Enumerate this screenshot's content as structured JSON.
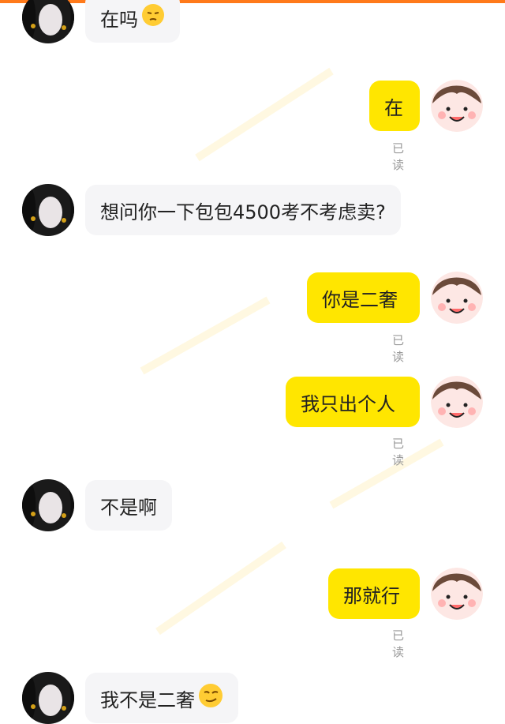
{
  "colors": {
    "accent_top": "#ff7a1a",
    "outgoing_bubble": "#ffe600",
    "incoming_bubble": "#f5f5f7",
    "read_text": "#9a9a9a"
  },
  "messages": [
    {
      "side": "in",
      "text": "在吗",
      "emoji": "sleepy-face-icon"
    },
    {
      "side": "out",
      "text": "在",
      "status": "已读"
    },
    {
      "side": "in",
      "text": "想问你一下包包4500考不考虑卖?"
    },
    {
      "side": "out",
      "text": "你是二奢",
      "status": "已读"
    },
    {
      "side": "out",
      "text": "我只出个人",
      "status": "已读"
    },
    {
      "side": "in",
      "text": "不是啊"
    },
    {
      "side": "out",
      "text": "那就行",
      "status": "已读"
    },
    {
      "side": "in",
      "text": "我不是二奢",
      "emoji": "smirk-face-icon"
    }
  ]
}
